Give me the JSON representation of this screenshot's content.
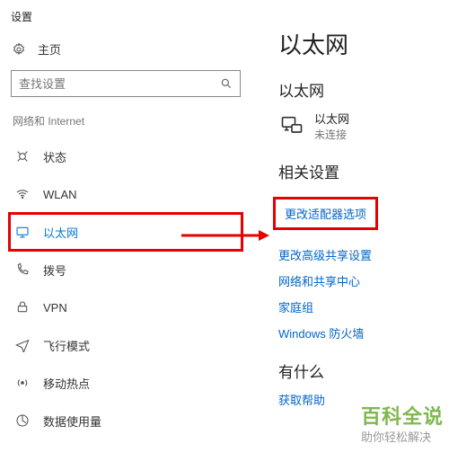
{
  "window": {
    "title": "设置"
  },
  "home": {
    "label": "主页"
  },
  "search": {
    "placeholder": "查找设置"
  },
  "section": {
    "label": "网络和 Internet"
  },
  "nav": {
    "items": [
      {
        "label": "状态"
      },
      {
        "label": "WLAN"
      },
      {
        "label": "以太网"
      },
      {
        "label": "拨号"
      },
      {
        "label": "VPN"
      },
      {
        "label": "飞行模式"
      },
      {
        "label": "移动热点"
      },
      {
        "label": "数据使用量"
      }
    ]
  },
  "right": {
    "title": "以太网",
    "adapter_heading": "以太网",
    "adapter": {
      "name": "以太网",
      "status": "未连接"
    },
    "related_heading": "相关设置",
    "links": {
      "adapter_options": "更改适配器选项",
      "advanced_sharing": "更改高级共享设置",
      "network_center": "网络和共享中心",
      "homegroup": "家庭组",
      "firewall": "Windows 防火墙"
    },
    "help_heading": "有什么",
    "help_link": "获取帮助"
  },
  "watermark": {
    "line1": "百科全说",
    "line2": "助你轻松解决"
  }
}
